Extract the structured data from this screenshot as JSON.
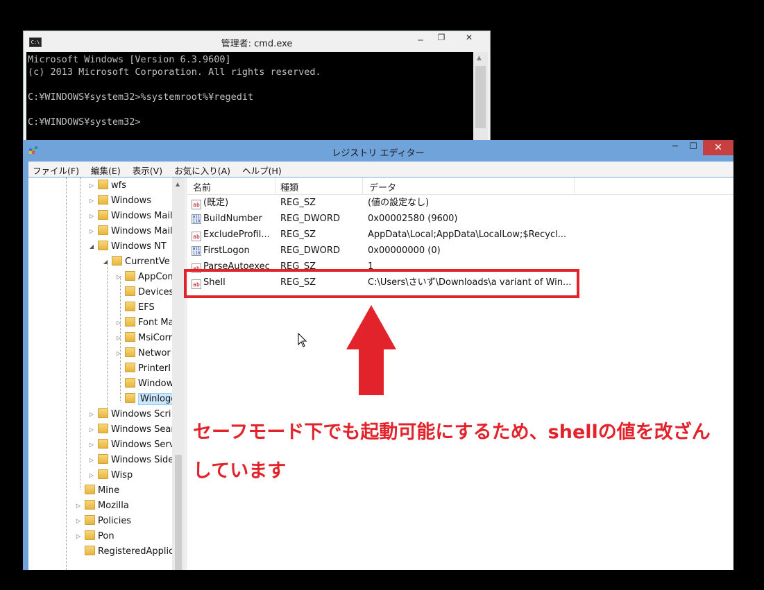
{
  "cmd": {
    "title": "管理者: cmd.exe",
    "icon_label": "C:\\",
    "controls": [
      "─",
      "❐",
      "✕"
    ],
    "lines": [
      "Microsoft Windows [Version 6.3.9600]",
      "(c) 2013 Microsoft Corporation. All rights reserved.",
      "",
      "C:¥WINDOWS¥system32>%systemroot%¥regedit",
      "",
      "C:¥WINDOWS¥system32>"
    ]
  },
  "regedit": {
    "title": "レジストリ エディター",
    "controls": {
      "minimize": "─",
      "maximize": "☐",
      "close": "✕"
    },
    "menu": [
      "ファイル(F)",
      "編集(E)",
      "表示(V)",
      "お気に入り(A)",
      "ヘルプ(H)"
    ],
    "tree": [
      {
        "label": "wfs",
        "expander": "▷"
      },
      {
        "label": "Windows",
        "expander": "▷"
      },
      {
        "label": "Windows Mail",
        "expander": "▷"
      },
      {
        "label": "Windows Mail",
        "expander": "▷"
      },
      {
        "label": "Windows NT",
        "expander": "◢"
      },
      {
        "label": "CurrentVe",
        "expander": "◢"
      },
      {
        "label": "AppCon",
        "expander": "▷"
      },
      {
        "label": "Devices",
        "expander": ""
      },
      {
        "label": "EFS",
        "expander": ""
      },
      {
        "label": "Font Ma",
        "expander": "▷"
      },
      {
        "label": "MsiCorr",
        "expander": "▷"
      },
      {
        "label": "Networ",
        "expander": "▷"
      },
      {
        "label": "PrinterI",
        "expander": ""
      },
      {
        "label": "Window",
        "expander": ""
      },
      {
        "label": "Winlogo",
        "expander": "",
        "selected": true
      },
      {
        "label": "Windows Scri",
        "expander": "▷"
      },
      {
        "label": "Windows Sear",
        "expander": "▷"
      },
      {
        "label": "Windows Serv",
        "expander": "▷"
      },
      {
        "label": "Windows Side",
        "expander": "▷"
      },
      {
        "label": "Wisp",
        "expander": "▷"
      },
      {
        "label": "Mine",
        "expander": ""
      },
      {
        "label": "Mozilla",
        "expander": "▷"
      },
      {
        "label": "Policies",
        "expander": "▷"
      },
      {
        "label": "Pon",
        "expander": "▷"
      },
      {
        "label": "RegisteredApplic",
        "expander": ""
      }
    ],
    "columns": [
      "名前",
      "種類",
      "データ"
    ],
    "values": [
      {
        "icon": "ab",
        "name": "(既定)",
        "type": "REG_SZ",
        "data": "(値の設定なし)"
      },
      {
        "icon": "011\n110",
        "name": "BuildNumber",
        "type": "REG_DWORD",
        "data": "0x00002580 (9600)"
      },
      {
        "icon": "ab",
        "name": "ExcludeProfil...",
        "type": "REG_SZ",
        "data": "AppData\\Local;AppData\\LocalLow;$Recycl..."
      },
      {
        "icon": "011\n110",
        "name": "FirstLogon",
        "type": "REG_DWORD",
        "data": "0x00000000 (0)"
      },
      {
        "icon": "ab",
        "name": "ParseAutoexec",
        "type": "REG_SZ",
        "data": "1"
      },
      {
        "icon": "ab",
        "name": "Shell",
        "type": "REG_SZ",
        "data": "C:\\Users\\さいず\\Downloads\\a variant of Win..."
      }
    ]
  },
  "annotation": {
    "line1": "セーフモード下でも起動可能にするため、shellの値を改ざん",
    "line2": "しています",
    "color": "#e3232b"
  }
}
